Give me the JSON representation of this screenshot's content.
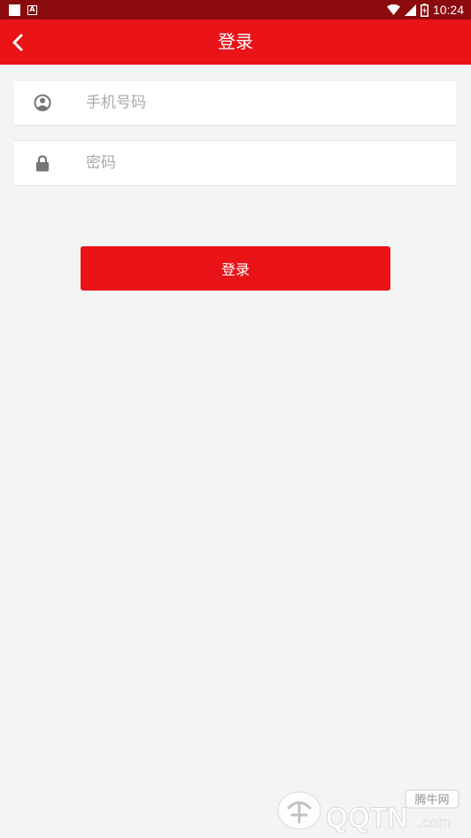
{
  "status_bar": {
    "time": "10:24"
  },
  "app_bar": {
    "title": "登录",
    "back_icon": "chevron-left-icon"
  },
  "form": {
    "phone": {
      "placeholder": "手机号码",
      "value": "",
      "icon": "user-circle-icon"
    },
    "password": {
      "placeholder": "密码",
      "value": "",
      "icon": "lock-icon"
    },
    "submit_label": "登录"
  },
  "watermark": {
    "text": "QQTN.com",
    "sub_text": "腾牛网"
  },
  "colors": {
    "primary": "#e91318",
    "status_bar": "#8b0a0e",
    "background": "#f4f4f4",
    "icon_gray": "#757575",
    "placeholder": "#a9a9a9"
  }
}
